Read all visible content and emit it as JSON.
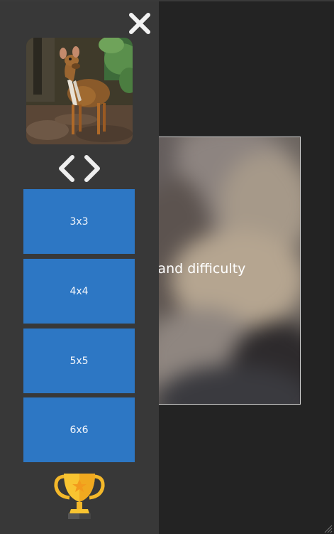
{
  "preview": {
    "hint_text": "age and difficulty"
  },
  "sidebar": {
    "close_icon": "close-icon",
    "thumbnail": "mouse-deer-photo",
    "nav": {
      "prev_icon": "chevron-left-icon",
      "next_icon": "chevron-right-icon"
    },
    "difficulties": [
      {
        "label": "3x3"
      },
      {
        "label": "4x4"
      },
      {
        "label": "5x5"
      },
      {
        "label": "6x6"
      }
    ],
    "trophy_icon": "trophy-icon"
  },
  "colors": {
    "background": "#232323",
    "sidebar": "#383838",
    "button": "#2d77c4",
    "button_text": "#f3f6fb"
  }
}
